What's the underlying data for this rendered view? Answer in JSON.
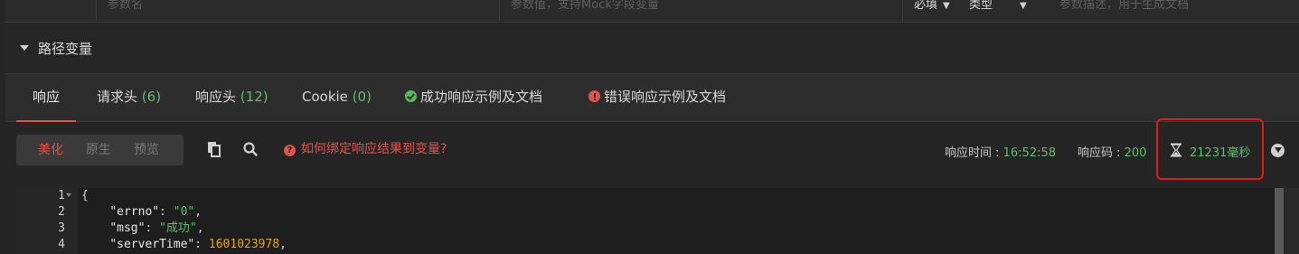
{
  "params_row": {
    "name_placeholder": "参数名",
    "value_placeholder": "参数值，支持Mock字段变量",
    "required_label": "必填",
    "type_label": "类型",
    "desc_placeholder": "参数描述，用于生成文档"
  },
  "path_vars": {
    "label": "路径变量"
  },
  "tabs": [
    {
      "label": "响应",
      "count": ""
    },
    {
      "label": "请求头",
      "count": "(6)"
    },
    {
      "label": "响应头",
      "count": "(12)"
    },
    {
      "label": "Cookie",
      "count": "(0)"
    },
    {
      "label": "成功响应示例及文档",
      "count": ""
    },
    {
      "label": "错误响应示例及文档",
      "count": ""
    }
  ],
  "toolbar": {
    "view_modes": [
      "美化",
      "原生",
      "预览"
    ],
    "help_text": "如何绑定响应结果到变量?",
    "response_time_label": "响应时间 : ",
    "response_time_value": "16:52:58",
    "response_code_label": "响应码 : ",
    "response_code_value": "200",
    "elapsed": "21231毫秒"
  },
  "editor": {
    "line_numbers": [
      "1",
      "2",
      "3",
      "4"
    ],
    "lines": [
      {
        "text": "{"
      },
      {
        "key": "\"errno\"",
        "value": "\"0\"",
        "value_type": "string"
      },
      {
        "key": "\"msg\"",
        "value": "\"成功\"",
        "value_type": "string"
      },
      {
        "key": "\"serverTime\"",
        "value": "1601023978",
        "value_type": "number"
      }
    ]
  },
  "colors": {
    "accent_red": "#e0544d",
    "success_green": "#5fbf6b",
    "number_orange": "#e5a50a",
    "highlight_box": "#e01b1b"
  }
}
